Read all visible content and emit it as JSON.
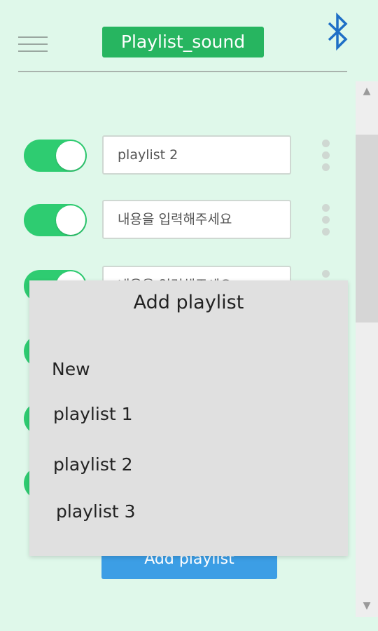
{
  "header": {
    "title": "Playlist_sound"
  },
  "rows": [
    {
      "value": "playlist 2",
      "placeholder": ""
    },
    {
      "value": "",
      "placeholder": "내용을 입력해주세요"
    },
    {
      "value": "",
      "placeholder": "내용을 입력해주세요"
    },
    {
      "value": "",
      "placeholder": ""
    },
    {
      "value": "",
      "placeholder": ""
    },
    {
      "value": "",
      "placeholder": ""
    }
  ],
  "add_button": {
    "label": "Add playlist"
  },
  "dialog": {
    "title": "Add playlist",
    "items": [
      "New",
      "playlist 1",
      "playlist 2",
      "playlist 3"
    ]
  },
  "colors": {
    "background": "#dff8ea",
    "title_bg": "#27b560",
    "toggle_on": "#2ecc71",
    "button": "#3c9ee5",
    "bluetooth": "#1f6fc6"
  },
  "icons": {
    "menu": "hamburger-menu-icon",
    "bluetooth": "bluetooth-icon",
    "more": "vertical-dots-icon"
  }
}
